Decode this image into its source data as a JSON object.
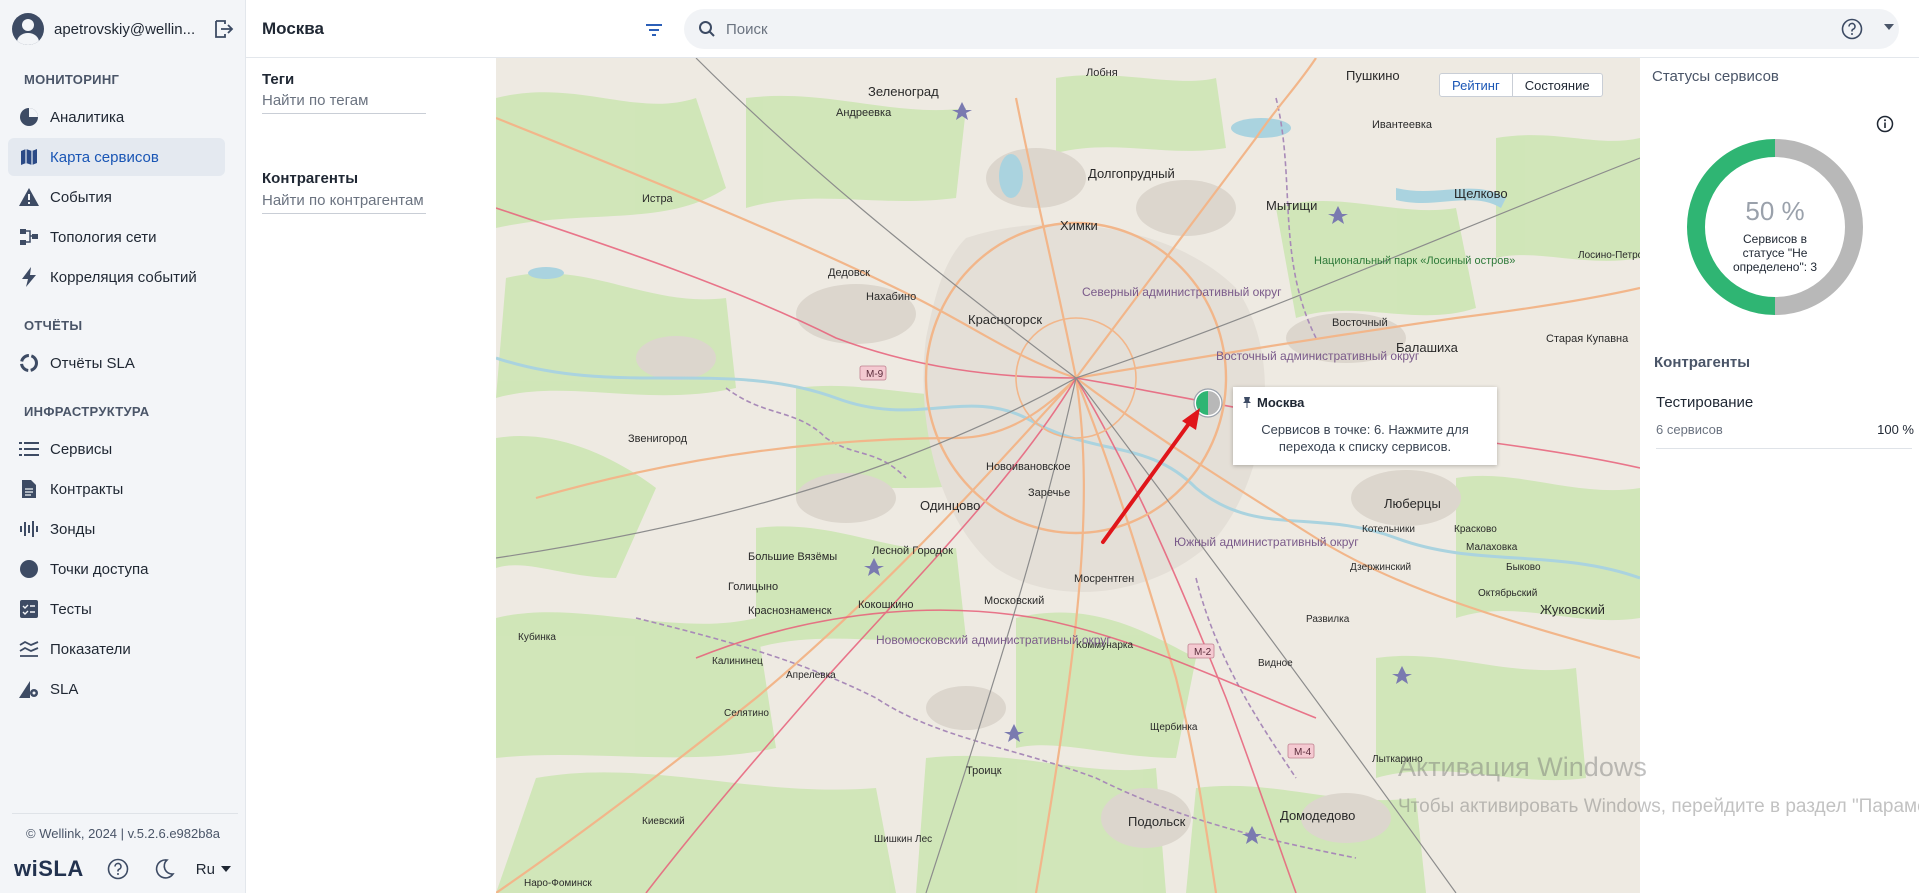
{
  "user": {
    "name": "apetrovskiy@wellin..."
  },
  "sidebar": {
    "sections": [
      {
        "title": "МОНИТОРИНГ"
      },
      {
        "title": "ОТЧЁТЫ"
      },
      {
        "title": "ИНФРАСТРУКТУРА"
      }
    ],
    "items": [
      {
        "label": "Аналитика",
        "icon": "pie-chart-icon"
      },
      {
        "label": "Карта сервисов",
        "icon": "map-icon",
        "active": true
      },
      {
        "label": "События",
        "icon": "warning-icon"
      },
      {
        "label": "Топология сети",
        "icon": "topology-icon"
      },
      {
        "label": "Корреляция событий",
        "icon": "lightning-icon"
      },
      {
        "label": "Отчёты SLA",
        "icon": "report-ring-icon"
      },
      {
        "label": "Сервисы",
        "icon": "list-icon"
      },
      {
        "label": "Контракты",
        "icon": "document-icon"
      },
      {
        "label": "Зонды",
        "icon": "probe-icon"
      },
      {
        "label": "Точки доступа",
        "icon": "circle-icon"
      },
      {
        "label": "Тесты",
        "icon": "checklist-icon"
      },
      {
        "label": "Показатели",
        "icon": "metrics-icon"
      },
      {
        "label": "SLA",
        "icon": "sla-gear-icon"
      }
    ],
    "copyright": "© Wellink, 2024 | v.5.2.6.e982b8a",
    "logo": "wiSLA",
    "language": "Ru"
  },
  "header": {
    "title": "Москва",
    "search_placeholder": "Поиск"
  },
  "filters": {
    "tags_label": "Теги",
    "tags_placeholder": "Найти по тегам",
    "contractors_label": "Контрагенты",
    "contractors_placeholder": "Найти по контрагентам"
  },
  "map": {
    "toggle": [
      "Рейтинг",
      "Состояние"
    ],
    "selected_toggle": "Рейтинг",
    "tooltip_title": "Москва",
    "tooltip_body": "Сервисов в точке: 6. Нажмите для перехода к списку сервисов.",
    "places": [
      "Зеленоград",
      "Андреевка",
      "Лобня",
      "Пушкино",
      "Ивантеевка",
      "Долгопрудный",
      "Мытищи",
      "Щелково",
      "Химки",
      "Истра",
      "Дедовск",
      "Нахабино",
      "Красногорск",
      "Северный административный округ",
      "Национальный парк «Лосиный остров»",
      "Восточный",
      "Балашиха",
      "Старая Купавна",
      "Лосино-Петровский",
      "Звенигород",
      "Новоивановское",
      "Заречье",
      "Одинцово",
      "Восточный административный округ",
      "Люберцы",
      "Котельники",
      "Красково",
      "Малаховка",
      "Большие Вязёмы",
      "Лесной Городок",
      "Голицыно",
      "Мосрентген",
      "Южный административный округ",
      "Дзержинский",
      "Быково",
      "Октябрьский",
      "Жуковский",
      "Краснознаменск",
      "Кокошкино",
      "Московский",
      "Развилка",
      "Коммунарка",
      "Видное",
      "Кубинка",
      "Калининец",
      "Апрелевка",
      "Новомосковский административный округ",
      "Селятино",
      "Щербинка",
      "Троицк",
      "Подольск",
      "Домодедово",
      "Киевский",
      "Шишкин Лес",
      "Наро-Фоминск",
      "Лыткарино"
    ],
    "roads": [
      "М-9",
      "М-2",
      "М-4"
    ],
    "pie_colors": {
      "ok": "#2fb573",
      "undefined": "#b8b8b8"
    }
  },
  "right_panel": {
    "title": "Статусы сервисов",
    "donut_percent": "50 %",
    "donut_caption": "Сервисов в статусе \"Не определено\": 3",
    "donut_segments": [
      {
        "status": "ok",
        "value": 3,
        "color": "#2fb573"
      },
      {
        "status": "undefined",
        "value": 3,
        "color": "#b8b8b8"
      }
    ],
    "contractors_title": "Контрагенты",
    "contractor": {
      "name": "Тестирование",
      "count": "6 сервисов",
      "percent": "100 %"
    }
  },
  "watermark": {
    "line1": "Активация Windows",
    "line2": "Чтобы активировать Windows, перейдите в раздел \"Параметры\"."
  }
}
